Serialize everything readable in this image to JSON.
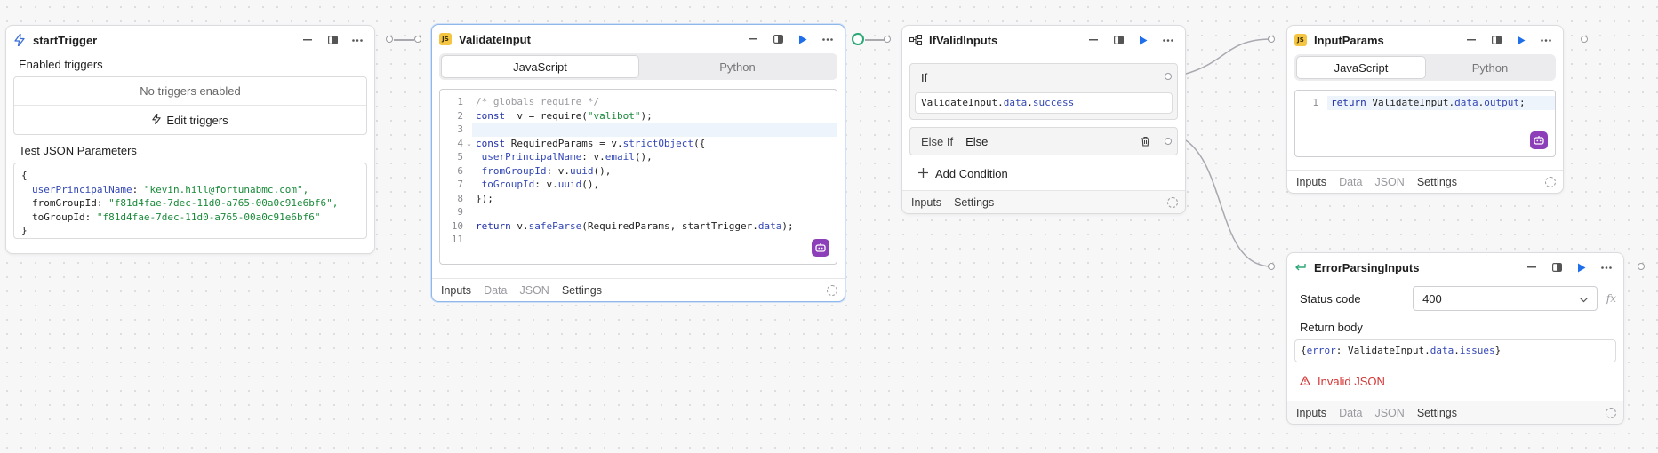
{
  "colors": {
    "accent": "#1f6feb",
    "ai_button": "#8c3fb8",
    "js_badge": "#f4c542",
    "error": "#d43434",
    "connected_handle": "#2aa876"
  },
  "nodes": {
    "start_trigger": {
      "title": "startTrigger",
      "icon": "bolt-icon",
      "enabled_triggers_label": "Enabled triggers",
      "no_triggers_text": "No triggers enabled",
      "edit_triggers_label": "Edit triggers",
      "test_json_label": "Test JSON Parameters",
      "json_lines": [
        {
          "text": "{"
        },
        {
          "key": "userPrincipalName",
          "value": "\"kevin.hill@fortunabmc.com\","
        },
        {
          "key": "fromGroupId",
          "value": "\"f81d4fae-7dec-11d0-a765-00a0c91e6bf6\","
        },
        {
          "key": "toGroupId",
          "value": "\"f81d4fae-7dec-11d0-a765-00a0c91e6bf6\""
        },
        {
          "text": "}"
        }
      ]
    },
    "validate_input": {
      "title": "ValidateInput",
      "badge": "JS",
      "tabs": [
        "JavaScript",
        "Python"
      ],
      "line_numbers": [
        "1",
        "2",
        "3",
        "4",
        "5",
        "6",
        "7",
        "8",
        "9",
        "10",
        "11"
      ],
      "footer": {
        "inputs": "Inputs",
        "data": "Data",
        "json": "JSON",
        "settings": "Settings"
      }
    },
    "if_valid_inputs": {
      "title": "IfValidInputs",
      "if_label": "If",
      "if_expr_ref": "ValidateInput",
      "if_expr_dot1": ".",
      "if_expr_prop1": "data",
      "if_expr_dot2": ".",
      "if_expr_prop2": "success",
      "else_if_label": "Else If",
      "else_label": "Else",
      "add_condition_label": "Add Condition",
      "footer": {
        "inputs": "Inputs",
        "settings": "Settings"
      }
    },
    "input_params": {
      "title": "InputParams",
      "badge": "JS",
      "tabs": [
        "JavaScript",
        "Python"
      ],
      "line_numbers": [
        "1"
      ],
      "footer": {
        "inputs": "Inputs",
        "data": "Data",
        "json": "JSON",
        "settings": "Settings"
      }
    },
    "error_parsing_inputs": {
      "title": "ErrorParsingInputs",
      "status_code_label": "Status code",
      "status_code_value": "400",
      "return_body_label": "Return body",
      "invalid_json_text": "Invalid JSON",
      "footer": {
        "inputs": "Inputs",
        "data": "Data",
        "json": "JSON",
        "settings": "Settings"
      }
    }
  }
}
